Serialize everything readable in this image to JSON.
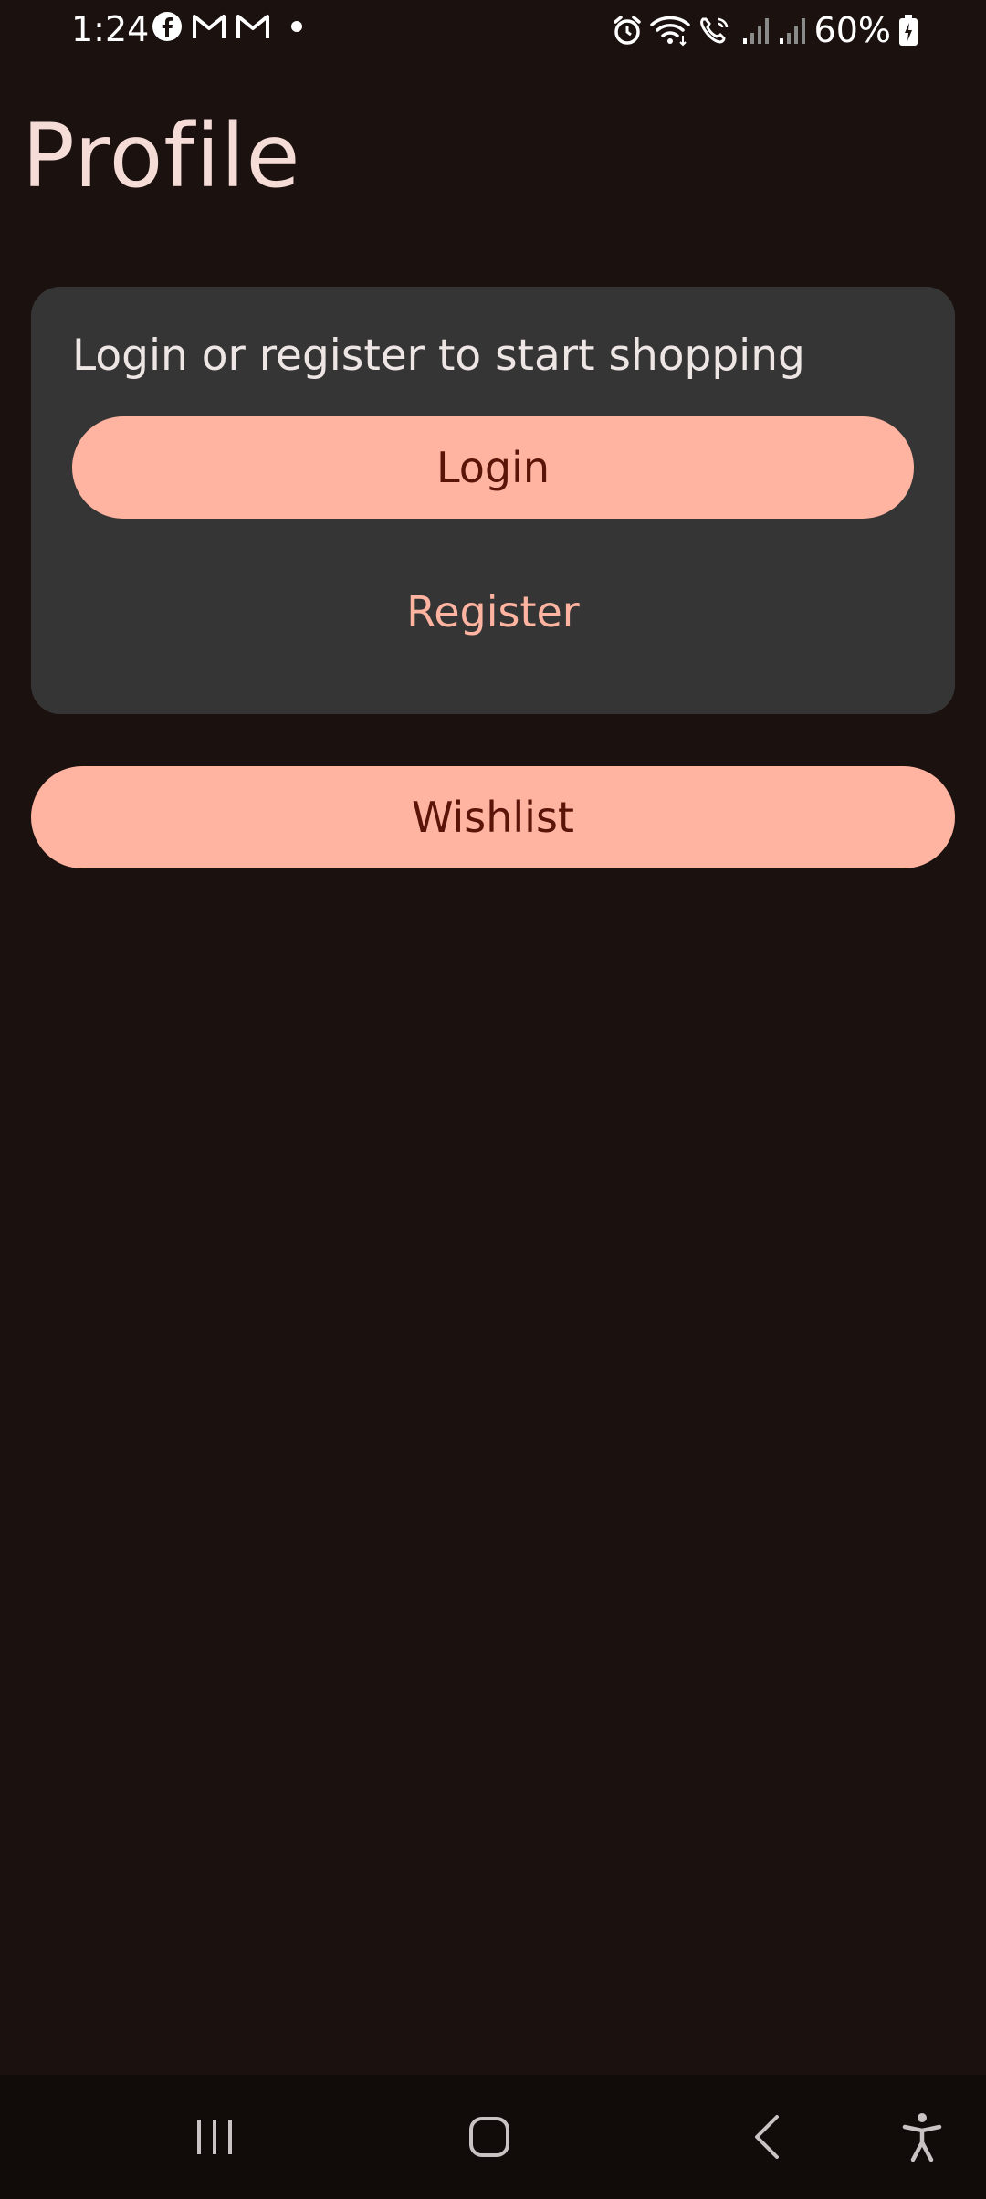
{
  "status_bar": {
    "time": "1:24",
    "left_icons": [
      "facebook-icon",
      "gmail-icon",
      "gmail-icon",
      "notification-dot-icon"
    ],
    "right_icons": [
      "alarm-icon",
      "wifi-icon",
      "wifi-calling-icon",
      "signal-icon",
      "signal-icon",
      "battery-charging-icon"
    ],
    "battery_percent": "60%"
  },
  "page": {
    "title": "Profile"
  },
  "auth_card": {
    "prompt": "Login or register to start shopping",
    "login_label": "Login",
    "register_label": "Register"
  },
  "wishlist": {
    "label": "Wishlist"
  },
  "nav_bar": {
    "buttons": [
      "recent-apps-icon",
      "home-icon",
      "back-icon",
      "accessibility-icon"
    ]
  },
  "colors": {
    "background": "#1b1210",
    "card": "#363535",
    "accent": "#ffb4a1",
    "on_accent": "#5b1408",
    "title": "#f6dcd7"
  }
}
